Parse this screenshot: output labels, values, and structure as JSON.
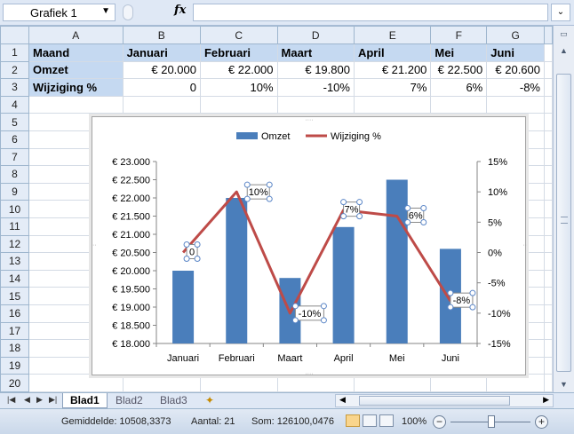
{
  "formula_bar": {
    "name_box": "Grafiek 1",
    "fx_label": "fx",
    "formula": ""
  },
  "columns": [
    "A",
    "B",
    "C",
    "D",
    "E",
    "F",
    "G"
  ],
  "rows": [
    [
      "Maand",
      "Januari",
      "Februari",
      "Maart",
      "April",
      "Mei",
      "Juni"
    ],
    [
      "Omzet",
      "€ 20.000",
      "€ 22.000",
      "€ 19.800",
      "€ 21.200",
      "€ 22.500",
      "€ 20.600"
    ],
    [
      "Wijziging %",
      "0",
      "10%",
      "-10%",
      "7%",
      "6%",
      "-8%"
    ]
  ],
  "row_numbers": [
    "1",
    "2",
    "3",
    "4",
    "5",
    "6",
    "7",
    "8",
    "9",
    "10",
    "11",
    "12",
    "13",
    "14",
    "15",
    "16",
    "17",
    "18",
    "19",
    "20"
  ],
  "chart_data": {
    "type": "bar",
    "categories": [
      "Januari",
      "Februari",
      "Maart",
      "April",
      "Mei",
      "Juni"
    ],
    "series": [
      {
        "name": "Omzet",
        "type": "bar",
        "axis": "left",
        "color": "#4a7ebb",
        "values": [
          20000,
          22000,
          19800,
          21200,
          22500,
          20600
        ]
      },
      {
        "name": "Wijziging %",
        "type": "line",
        "axis": "right",
        "color": "#be4b48",
        "values": [
          0,
          10,
          -10,
          7,
          6,
          -8
        ]
      }
    ],
    "data_labels": [
      "0",
      "10%",
      "-10%",
      "7%",
      "6%",
      "-8%"
    ],
    "y_left": {
      "min": 18000,
      "max": 23000,
      "step": 500,
      "ticks": [
        "€ 23.000",
        "€ 22.500",
        "€ 22.000",
        "€ 21.500",
        "€ 21.000",
        "€ 20.500",
        "€ 20.000",
        "€ 19.500",
        "€ 19.000",
        "€ 18.500",
        "€ 18.000"
      ]
    },
    "y_right": {
      "min": -15,
      "max": 15,
      "step": 5,
      "ticks": [
        "15%",
        "10%",
        "5%",
        "0%",
        "-5%",
        "-10%",
        "-15%"
      ]
    },
    "legend": [
      "Omzet",
      "Wijziging %"
    ],
    "legend_position": "top",
    "grid": false
  },
  "sheet_tabs": [
    "Blad1",
    "Blad2",
    "Blad3"
  ],
  "status": {
    "average": "Gemiddelde: 10508,3373",
    "count": "Aantal: 21",
    "sum": "Som: 126100,0476",
    "zoom": "100%",
    "minus": "−",
    "plus": "+"
  }
}
